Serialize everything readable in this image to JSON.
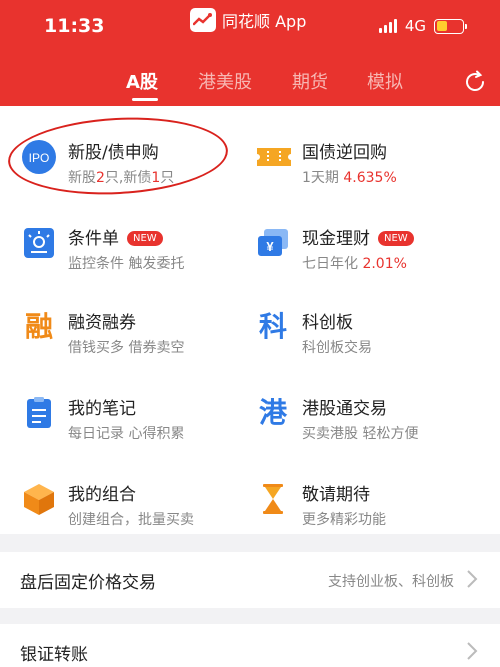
{
  "status_bar": {
    "time": "11:33",
    "app_name": "同花顺 App",
    "network": "4G"
  },
  "tabs": [
    {
      "label": "A股",
      "active": true
    },
    {
      "label": "港美股",
      "active": false
    },
    {
      "label": "期货",
      "active": false
    },
    {
      "label": "模拟",
      "active": false
    }
  ],
  "grid": {
    "ipo": {
      "title": "新股/债申购",
      "sub_a": "新股",
      "count_a": "2",
      "sub_b": "只,新债",
      "count_b": "1",
      "sub_c": "只",
      "icon_text": "IPO"
    },
    "repo": {
      "title": "国债逆回购",
      "sub_a": "1天期",
      "rate": "4.635%"
    },
    "condition": {
      "title": "条件单",
      "badge": "NEW",
      "sub": "监控条件 触发委托"
    },
    "cash": {
      "title": "现金理财",
      "badge": "NEW",
      "sub_a": "七日年化",
      "rate": "2.01%",
      "icon_text": "¥"
    },
    "margin": {
      "title": "融资融券",
      "sub": "借钱买多 借券卖空",
      "icon_text": "融"
    },
    "star": {
      "title": "科创板",
      "sub": "科创板交易",
      "icon_text": "科"
    },
    "notes": {
      "title": "我的笔记",
      "sub": "每日记录 心得积累"
    },
    "hk": {
      "title": "港股通交易",
      "sub": "买卖港股 轻松方便",
      "icon_text": "港"
    },
    "portfolio": {
      "title": "我的组合",
      "sub": "创建组合，批量买卖"
    },
    "coming": {
      "title": "敬请期待",
      "sub": "更多精彩功能"
    }
  },
  "rows": {
    "after_hours": {
      "label": "盘后固定价格交易",
      "hint": "支持创业板、科创板"
    },
    "bank_transfer": {
      "label": "银证转账"
    }
  },
  "colors": {
    "brand_red": "#e8332e",
    "blue": "#2f7ae5",
    "orange": "#f08a18"
  }
}
